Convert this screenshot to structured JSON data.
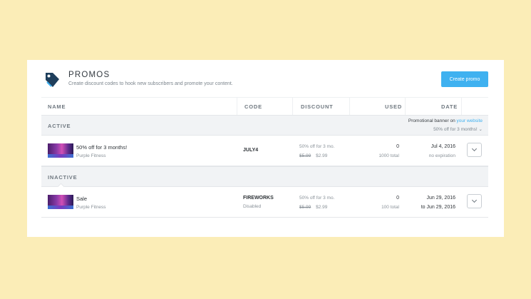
{
  "header": {
    "title": "PROMOS",
    "subtitle": "Create discount codes to hook new subscribers and promote your content.",
    "create_button": "Create promo",
    "icon": "tag-icon"
  },
  "columns": {
    "name": "NAME",
    "code": "CODE",
    "discount": "DISCOUNT",
    "used": "USED",
    "date": "DATE"
  },
  "active_section": {
    "label": "ACTIVE",
    "banner_prefix": "Promotional banner on",
    "banner_link": "your website",
    "banner_select": "50% off for 3 months!",
    "rows": [
      {
        "name": "50% off for 3 months!",
        "owner": "Purple Fitness",
        "code": "JULY4",
        "discount": "50% off for 3 mo.",
        "old_price": "$5.99",
        "new_price": "$2.99",
        "used": "0",
        "total": "1000 total",
        "date_start": "Jul 4, 2016",
        "date_end": "no expiration"
      }
    ]
  },
  "inactive_section": {
    "label": "INACTIVE",
    "rows": [
      {
        "name": "Sale",
        "owner": "Purple Fitness",
        "code": "FIREWORKS",
        "status": "Disabled",
        "discount": "50% off for 3 mo.",
        "old_price": "$5.99",
        "new_price": "$2.99",
        "used": "0",
        "total": "100 total",
        "date_start": "Jun 29, 2016",
        "date_end": "to Jun 29, 2016"
      }
    ]
  },
  "colors": {
    "background": "#fbedb7",
    "accent": "#3fb1f0",
    "icon": "#1f3f5c"
  }
}
